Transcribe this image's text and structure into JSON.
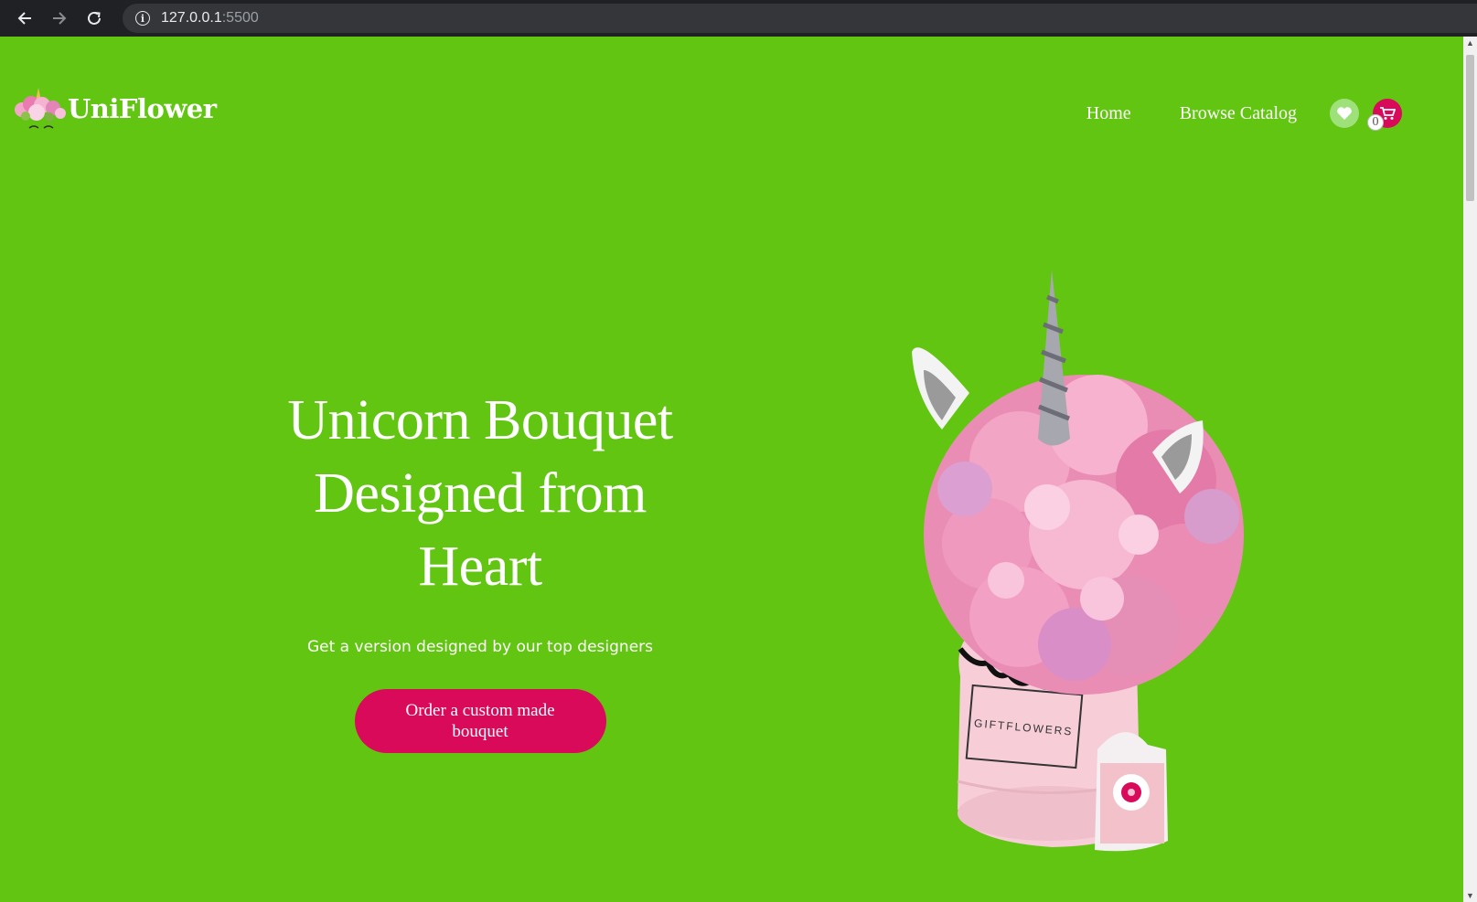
{
  "browser": {
    "back_icon": "arrow-left-icon",
    "forward_icon": "arrow-right-icon",
    "reload_icon": "reload-icon",
    "info_icon": "info-icon",
    "url_host": "127.0.0.1",
    "url_port": ":5500"
  },
  "header": {
    "logo_text": "UniFlower",
    "nav": [
      {
        "label": "Home"
      },
      {
        "label": "Browse Catalog"
      }
    ],
    "wishlist_icon": "heart-icon",
    "cart_icon": "cart-icon",
    "cart_count": "0"
  },
  "hero": {
    "title_line1": "Unicorn Bouquet",
    "title_line2": "Designed from",
    "title_line3": "Heart",
    "subtitle": "Get a version designed by our top designers",
    "cta_label": "Order a custom made bouquet",
    "image_label": "GIFTFLOWERS"
  },
  "colors": {
    "background": "#62c512",
    "accent": "#d90a5a",
    "wishlist_bg": "#9ee07a"
  }
}
